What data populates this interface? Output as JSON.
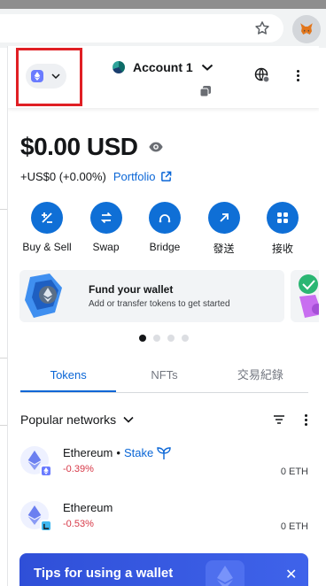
{
  "browser": {
    "star_icon": "star-icon",
    "extension_icon": "metamask-fox-icon"
  },
  "header": {
    "network_icon": "ethereum-network-icon",
    "account_name": "Account 1",
    "copy_icon": "copy-icon",
    "globe_icon": "globe-icon",
    "menu_icon": "kebab-menu-icon"
  },
  "balance": {
    "amount": "$0.00",
    "currency": "USD",
    "change": "+US$0 (+0.00%)",
    "portfolio_label": "Portfolio"
  },
  "actions": [
    {
      "label": "Buy & Sell",
      "icon": "buy-sell-icon"
    },
    {
      "label": "Swap",
      "icon": "swap-icon"
    },
    {
      "label": "Bridge",
      "icon": "bridge-icon"
    },
    {
      "label": "發送",
      "icon": "send-icon"
    },
    {
      "label": "接收",
      "icon": "receive-icon"
    }
  ],
  "promo": {
    "title": "Fund your wallet",
    "subtitle": "Add or transfer tokens to get started",
    "page_count": 4,
    "active_page": 1
  },
  "tabs": [
    {
      "label": "Tokens",
      "active": true
    },
    {
      "label": "NFTs",
      "active": false
    },
    {
      "label": "交易紀錄",
      "active": false
    }
  ],
  "filter": {
    "label": "Popular networks",
    "sort_icon": "sort-icon",
    "more_icon": "kebab-menu-icon"
  },
  "tokens": [
    {
      "name": "Ethereum",
      "separator": "•",
      "stake_label": "Stake",
      "change": "-0.39%",
      "balance": "0 ETH",
      "badge_color": "#6a7bff"
    },
    {
      "name": "Ethereum",
      "change": "-0.53%",
      "balance": "0 ETH",
      "badge_color": "#3fb8f0"
    }
  ],
  "tips": {
    "text": "Tips for using a wallet",
    "close_label": "✕"
  },
  "colors": {
    "accent": "#0a66d6",
    "negative": "#d73847",
    "highlight": "#e01f24"
  }
}
